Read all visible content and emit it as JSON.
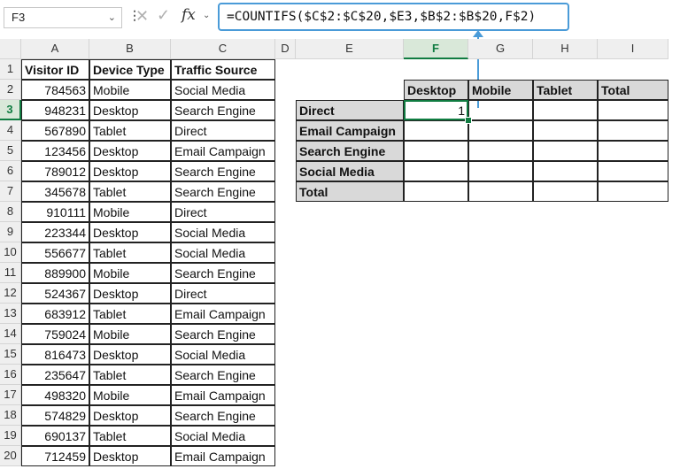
{
  "formula_bar": {
    "name_box": "F3",
    "formula": "=COUNTIFS($C$2:$C$20,$E3,$B$2:$B$20,F$2)",
    "fx_label": "fx"
  },
  "columns": [
    "A",
    "B",
    "C",
    "D",
    "E",
    "F",
    "G",
    "H",
    "I"
  ],
  "rows": [
    "1",
    "2",
    "3",
    "4",
    "5",
    "6",
    "7",
    "8",
    "9",
    "10",
    "11",
    "12",
    "13",
    "14",
    "15",
    "16",
    "17",
    "18",
    "19",
    "20"
  ],
  "data_table": {
    "headers": [
      "Visitor ID",
      "Device Type",
      "Traffic Source"
    ],
    "rows": [
      [
        "784563",
        "Mobile",
        "Social Media"
      ],
      [
        "948231",
        "Desktop",
        "Search Engine"
      ],
      [
        "567890",
        "Tablet",
        "Direct"
      ],
      [
        "123456",
        "Desktop",
        "Email Campaign"
      ],
      [
        "789012",
        "Desktop",
        "Search Engine"
      ],
      [
        "345678",
        "Tablet",
        "Search Engine"
      ],
      [
        "910111",
        "Mobile",
        "Direct"
      ],
      [
        "223344",
        "Desktop",
        "Social Media"
      ],
      [
        "556677",
        "Tablet",
        "Social Media"
      ],
      [
        "889900",
        "Mobile",
        "Search Engine"
      ],
      [
        "524367",
        "Desktop",
        "Direct"
      ],
      [
        "683912",
        "Tablet",
        "Email Campaign"
      ],
      [
        "759024",
        "Mobile",
        "Search Engine"
      ],
      [
        "816473",
        "Desktop",
        "Social Media"
      ],
      [
        "235647",
        "Tablet",
        "Search Engine"
      ],
      [
        "498320",
        "Mobile",
        "Email Campaign"
      ],
      [
        "574829",
        "Desktop",
        "Search Engine"
      ],
      [
        "690137",
        "Tablet",
        "Social Media"
      ],
      [
        "712459",
        "Desktop",
        "Email Campaign"
      ]
    ]
  },
  "summary_table": {
    "col_headers": [
      "Desktop",
      "Mobile",
      "Tablet",
      "Total"
    ],
    "row_headers": [
      "Direct",
      "Email Campaign",
      "Search Engine",
      "Social Media",
      "Total"
    ],
    "values": [
      [
        "1",
        "",
        "",
        ""
      ],
      [
        "",
        "",
        "",
        ""
      ],
      [
        "",
        "",
        "",
        ""
      ],
      [
        "",
        "",
        "",
        ""
      ],
      [
        "",
        "",
        "",
        ""
      ]
    ]
  },
  "colors": {
    "selection": "#107c41",
    "formula_highlight": "#4a9bd8",
    "header_fill": "#d9d9d9"
  }
}
